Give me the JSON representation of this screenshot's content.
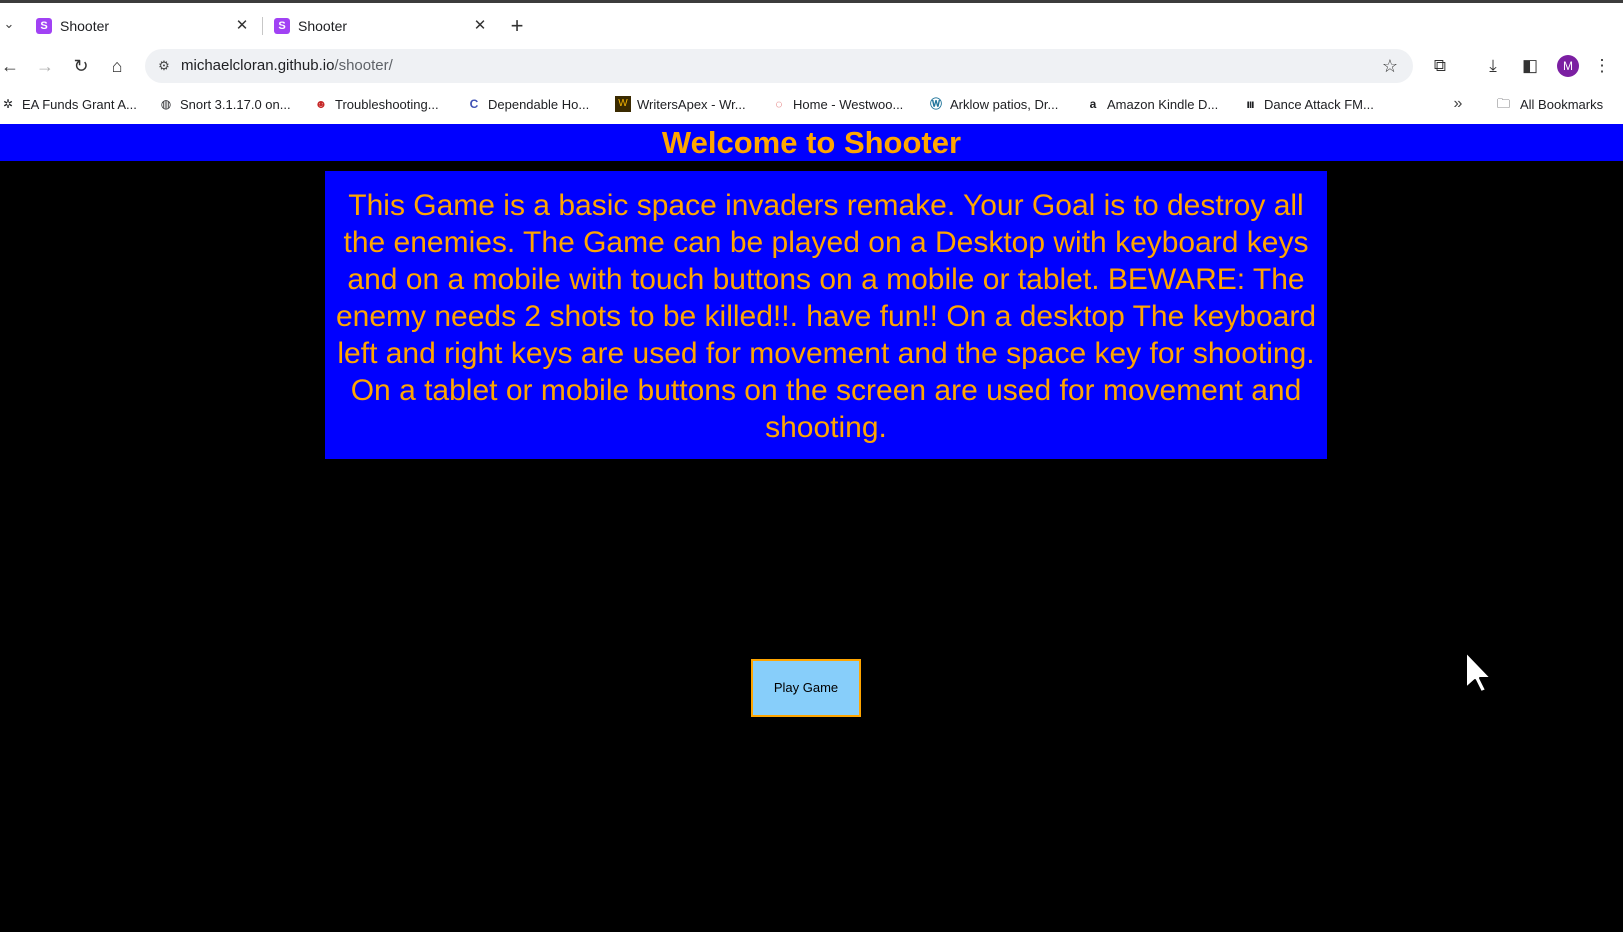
{
  "browser": {
    "tabs": [
      {
        "title": "Shooter",
        "favicon": "shooter-favicon",
        "favicon_letter": "S"
      },
      {
        "title": "Shooter",
        "favicon": "shooter-favicon",
        "favicon_letter": "S"
      }
    ],
    "new_tab_icon": "+",
    "url_host": "michaelcloran.github.io",
    "url_path": "/shooter/",
    "profile_initial": "M",
    "bookmarks": [
      {
        "label": "EA Funds Grant A...",
        "icon": "ea-funds-icon"
      },
      {
        "label": "Snort 3.1.17.0 on...",
        "icon": "globe-icon"
      },
      {
        "label": "Troubleshooting...",
        "icon": "devil-icon"
      },
      {
        "label": "Dependable Ho...",
        "icon": "c-logo-icon"
      },
      {
        "label": "WritersApex - Wr...",
        "icon": "writersapex-icon"
      },
      {
        "label": "Home - Westwoo...",
        "icon": "westwood-icon"
      },
      {
        "label": "Arklow patios, Dr...",
        "icon": "wordpress-icon"
      },
      {
        "label": "Amazon Kindle D...",
        "icon": "amazon-icon"
      },
      {
        "label": "Dance Attack FM...",
        "icon": "dance-attack-icon"
      }
    ],
    "all_bookmarks_label": "All Bookmarks"
  },
  "page": {
    "title": "Welcome to Shooter",
    "description": "This Game is a basic space invaders remake. Your Goal is to destroy all the enemies. The Game can be played on a Desktop with keyboard keys and on a mobile with touch buttons on a mobile or tablet. BEWARE: The enemy needs 2 shots to be killed!!. have fun!! On a desktop The keyboard left and right keys are used for movement and the space key for shooting. On a tablet or mobile buttons on the screen are used for movement and shooting.",
    "play_button_label": "Play Game"
  },
  "colors": {
    "banner_bg": "#0000ff",
    "text_accent": "#ffa500",
    "page_bg": "#000000",
    "button_bg": "#87cefa"
  }
}
